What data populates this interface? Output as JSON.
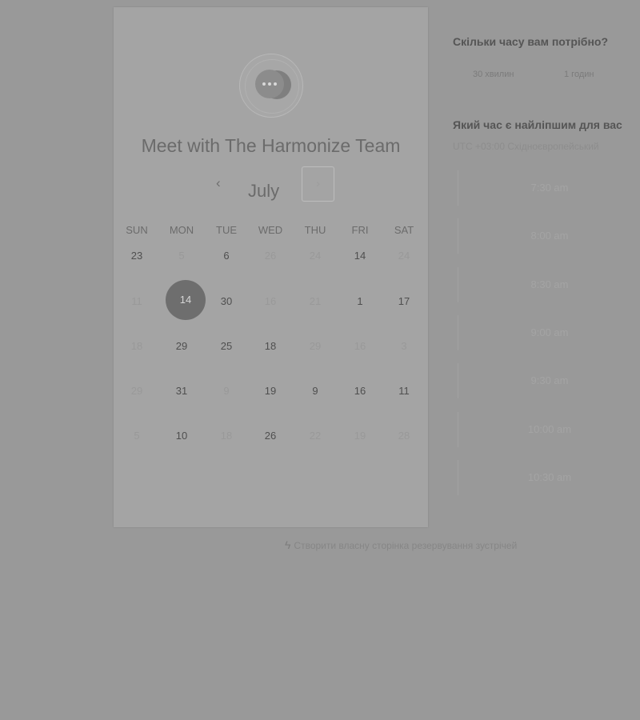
{
  "card": {
    "title": "Meet with The Harmonize Team",
    "month": "July",
    "prev_icon": "‹",
    "next_icon": "›",
    "weekdays": [
      "SUN",
      "MON",
      "TUE",
      "WED",
      "THU",
      "FRI",
      "SAT"
    ],
    "weeks": [
      [
        {
          "t": "23",
          "a": true
        },
        {
          "t": "5",
          "a": false
        },
        {
          "t": "6",
          "a": true
        },
        {
          "t": "26",
          "a": false
        },
        {
          "t": "24",
          "a": false
        },
        {
          "t": "14",
          "a": true
        },
        {
          "t": "24",
          "a": false
        }
      ],
      [
        {
          "t": "11",
          "a": false
        },
        {
          "t": "14",
          "a": true,
          "selected": true
        },
        {
          "t": "30",
          "a": true
        },
        {
          "t": "16",
          "a": false
        },
        {
          "t": "21",
          "a": false
        },
        {
          "t": "1",
          "a": true
        },
        {
          "t": "17",
          "a": true
        }
      ],
      [
        {
          "t": "18",
          "a": false
        },
        {
          "t": "29",
          "a": true
        },
        {
          "t": "25",
          "a": true
        },
        {
          "t": "18",
          "a": true
        },
        {
          "t": "29",
          "a": false
        },
        {
          "t": "16",
          "a": false
        },
        {
          "t": "3",
          "a": false
        }
      ],
      [
        {
          "t": "29",
          "a": false
        },
        {
          "t": "31",
          "a": true
        },
        {
          "t": "9",
          "a": false
        },
        {
          "t": "19",
          "a": true
        },
        {
          "t": "9",
          "a": true
        },
        {
          "t": "16",
          "a": true
        },
        {
          "t": "11",
          "a": true
        }
      ],
      [
        {
          "t": "5",
          "a": false
        },
        {
          "t": "10",
          "a": true
        },
        {
          "t": "18",
          "a": false
        },
        {
          "t": "26",
          "a": true
        },
        {
          "t": "22",
          "a": false
        },
        {
          "t": "19",
          "a": false
        },
        {
          "t": "28",
          "a": false
        }
      ]
    ]
  },
  "right": {
    "duration_question": "Скільки часу вам потрібно?",
    "durations": [
      "30 хвилин",
      "1 годин"
    ],
    "time_question": "Який час є найліпшим для вас",
    "timezone": "UTC +03:00 Східноєвропейський",
    "slots": [
      "7:30 am",
      "8:00 am",
      "8:30 am",
      "9:00 am",
      "9:30 am",
      "10:00 am",
      "10:30 am"
    ]
  },
  "footer": {
    "icon": "ϟ",
    "text": "Створити власну сторінка резервування зустрічей"
  }
}
